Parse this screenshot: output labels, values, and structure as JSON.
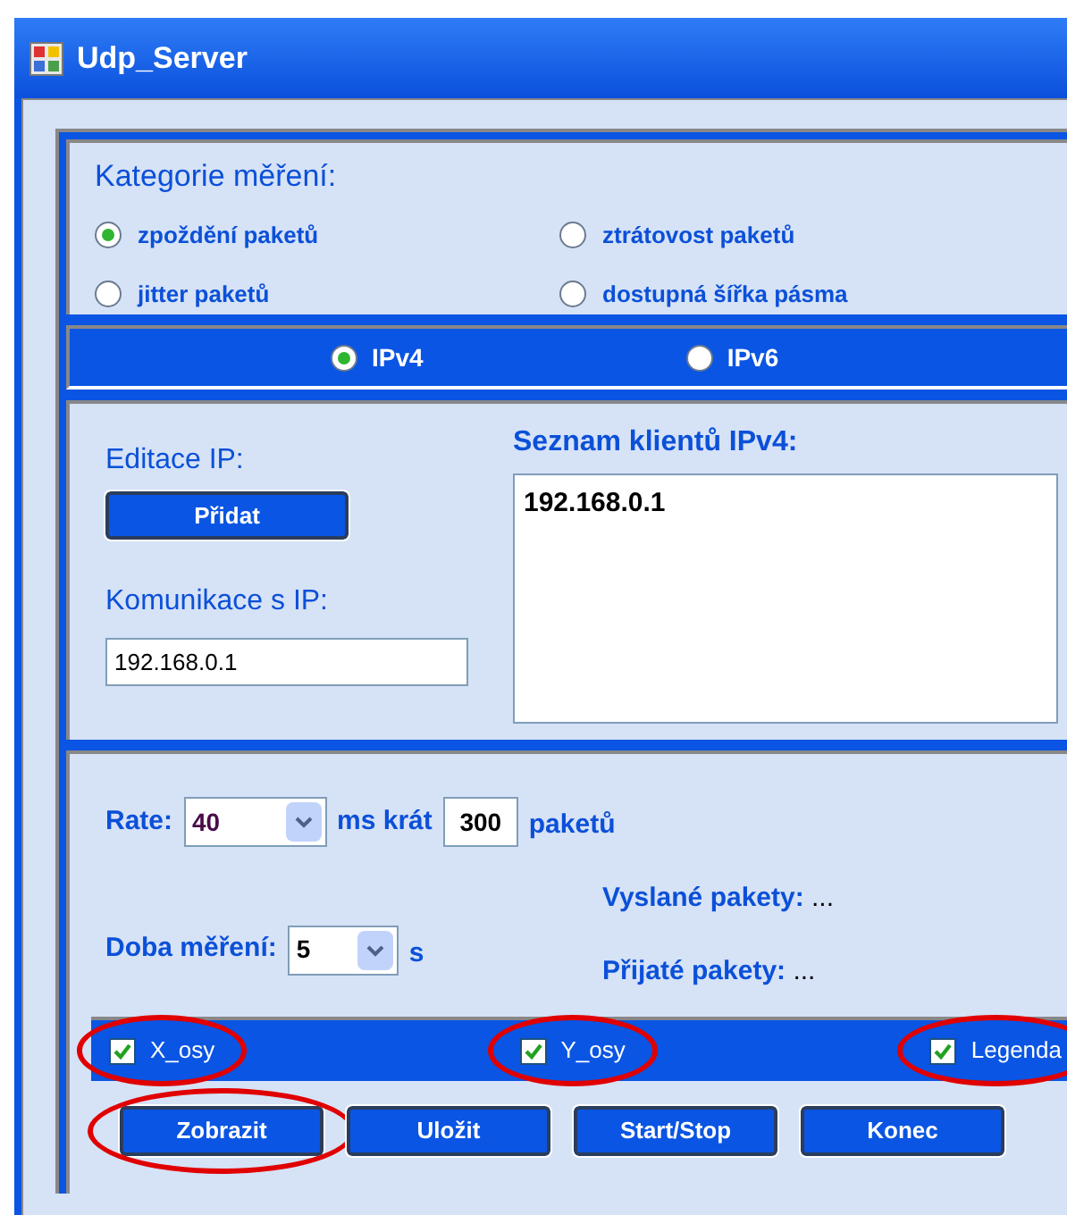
{
  "window": {
    "title": "Udp_Server"
  },
  "measurement_category": {
    "label": "Kategorie měření:",
    "options": [
      {
        "label": "zpoždění paketů",
        "selected": true
      },
      {
        "label": "ztrátovost paketů",
        "selected": false
      },
      {
        "label": "jitter paketů",
        "selected": false
      },
      {
        "label": "dostupná šířka pásma",
        "selected": false
      }
    ]
  },
  "ip_version": [
    {
      "label": "IPv4",
      "selected": true
    },
    {
      "label": "IPv6",
      "selected": false
    }
  ],
  "ip_panel": {
    "edit_label": "Editace IP:",
    "add_button": "Přidat",
    "comm_label": "Komunikace s IP:",
    "comm_value": "192.168.0.1",
    "list_label": "Seznam klientů IPv4:",
    "clients": [
      "192.168.0.1"
    ]
  },
  "rate": {
    "label": "Rate:",
    "value": "40",
    "unit": "ms krát",
    "count": "300",
    "count_unit": "paketů"
  },
  "duration": {
    "label": "Doba měření:",
    "value": "5",
    "unit": "s"
  },
  "sent": {
    "label": "Vyslané pakety:",
    "value": "..."
  },
  "received": {
    "label": "Přijaté pakety:",
    "value": "..."
  },
  "axes": [
    {
      "label": "X_osy",
      "checked": true,
      "circled": true
    },
    {
      "label": "Y_osy",
      "checked": true,
      "circled": true
    },
    {
      "label": "Legenda",
      "checked": true,
      "circled": true
    }
  ],
  "buttons": [
    {
      "label": "Zobrazit",
      "circled": true
    },
    {
      "label": "Uložit",
      "circled": false
    },
    {
      "label": "Start/Stop",
      "circled": false
    },
    {
      "label": "Konec",
      "circled": false
    }
  ]
}
